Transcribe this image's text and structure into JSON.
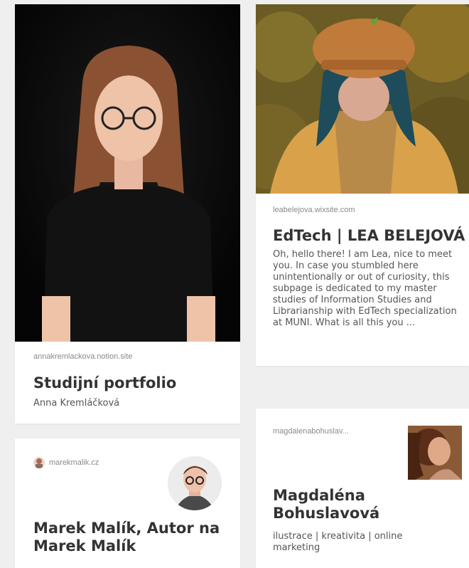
{
  "cards": [
    {
      "domain": "annakremlackova.notion.site",
      "title": "Studijní portfolio",
      "subtitle": "Anna Kremláčková",
      "image": "portrait-photo"
    },
    {
      "domain": "leabelejova.wixsite.com",
      "title": "EdTech | LEA BELEJOVÁ",
      "description": "Oh, hello there! I am Lea, nice to meet you. In case you stumbled here unintentionally or out of curiosity, this subpage is dedicated to my master studies of Information Studies and Librarianship with EdTech specialization at MUNI. What is all this you ...",
      "image": "portrait-photo"
    },
    {
      "domain": "marekmalik.cz",
      "title": "Marek Malík, Autor na Marek Malík",
      "image": "avatar-photo"
    },
    {
      "domain": "magdalenabohuslav...",
      "title": "Magdaléna Bohuslavová",
      "subtitle": "ilustrace | kreativita | online marketing",
      "image": "thumbnail-photo"
    }
  ]
}
